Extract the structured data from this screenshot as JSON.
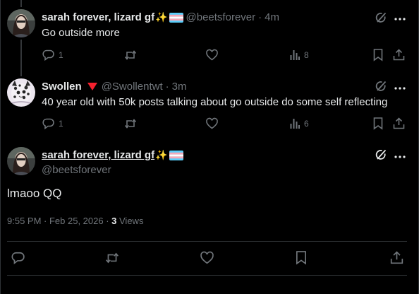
{
  "tweet1": {
    "name": "sarah forever, lizard gf",
    "handle": "@beetsforever",
    "time": "4m",
    "text": "Go outside more",
    "replies": "1",
    "views": "8"
  },
  "tweet2": {
    "name": "Swollen",
    "handle": "@Swollentwt",
    "time": "3m",
    "text": "40 year old with 50k posts talking about go outside do some self reflecting",
    "replies": "1",
    "views": "6"
  },
  "main": {
    "name": "sarah forever, lizard gf",
    "handle": "@beetsforever",
    "text": "lmaoo QQ",
    "timestamp": "9:55 PM · Feb 25, 2026 · ",
    "views_count": "3",
    "views_label": "Views"
  },
  "colors": {
    "badge_red": "#f4212e",
    "muted": "#71767b",
    "text": "#e7e9ea",
    "divider": "#2f3336"
  },
  "icons": [
    "grok-icon",
    "more-icon",
    "reply-icon",
    "retweet-icon",
    "like-icon",
    "views-icon",
    "bookmark-icon",
    "share-icon"
  ]
}
